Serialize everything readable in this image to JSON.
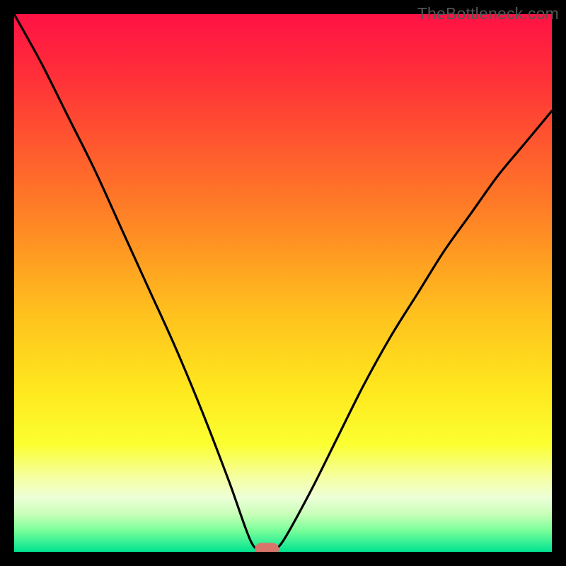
{
  "watermark": "TheBottleneck.com",
  "chart_data": {
    "type": "line",
    "title": "",
    "xlabel": "",
    "ylabel": "",
    "xlim": [
      0,
      100
    ],
    "ylim": [
      0,
      100
    ],
    "curve": {
      "name": "bottleneck-curve",
      "x": [
        0,
        5,
        10,
        15,
        20,
        25,
        30,
        35,
        40,
        44,
        46,
        48,
        50,
        55,
        60,
        65,
        70,
        75,
        80,
        85,
        90,
        95,
        100
      ],
      "y": [
        100,
        91,
        81,
        71,
        60,
        49,
        38,
        26,
        13,
        2,
        0.5,
        0.5,
        2,
        11,
        21,
        31,
        40,
        48,
        56,
        63,
        70,
        76,
        82
      ]
    },
    "optimal_marker": {
      "x": 47,
      "y": 0.5,
      "color": "#d8756b"
    },
    "gradient_stops": [
      {
        "offset": 0.0,
        "color": "#ff1244"
      },
      {
        "offset": 0.1,
        "color": "#ff2b3a"
      },
      {
        "offset": 0.25,
        "color": "#ff5a2e"
      },
      {
        "offset": 0.4,
        "color": "#ff8a24"
      },
      {
        "offset": 0.55,
        "color": "#ffbf1e"
      },
      {
        "offset": 0.7,
        "color": "#ffe81e"
      },
      {
        "offset": 0.8,
        "color": "#fbff30"
      },
      {
        "offset": 0.86,
        "color": "#f6ffa0"
      },
      {
        "offset": 0.9,
        "color": "#ecffd8"
      },
      {
        "offset": 0.93,
        "color": "#c8ffb8"
      },
      {
        "offset": 0.96,
        "color": "#7aff9a"
      },
      {
        "offset": 1.0,
        "color": "#00e390"
      }
    ]
  }
}
